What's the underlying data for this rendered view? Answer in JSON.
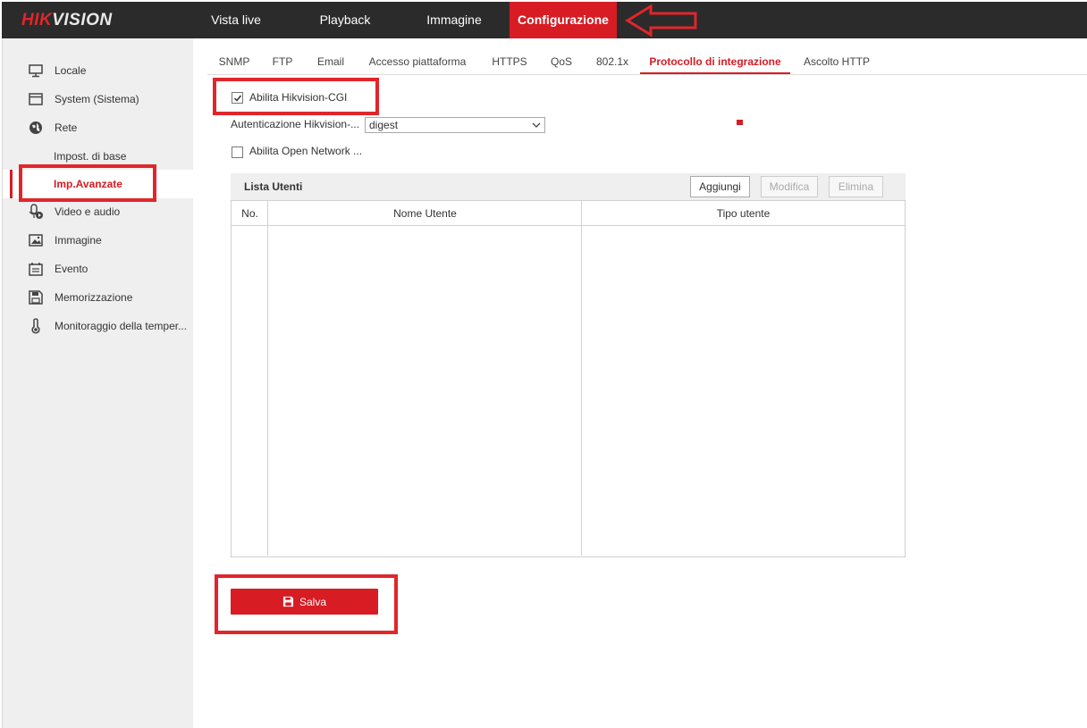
{
  "header": {
    "logo_red": "HIK",
    "logo_white": "VISION",
    "nav": [
      {
        "label": "Vista live"
      },
      {
        "label": "Playback"
      },
      {
        "label": "Immagine"
      },
      {
        "label": "Configurazione",
        "active": true
      }
    ]
  },
  "sidebar": {
    "items": [
      {
        "label": "Locale",
        "icon": "monitor-icon"
      },
      {
        "label": "System (Sistema)",
        "icon": "window-icon"
      },
      {
        "label": "Rete",
        "icon": "globe-icon"
      },
      {
        "label": "Impost. di base",
        "sub": true
      },
      {
        "label": "Imp.Avanzate",
        "sub": true,
        "active": true
      },
      {
        "label": "Video e audio",
        "icon": "microphone-icon"
      },
      {
        "label": "Immagine",
        "icon": "image-icon"
      },
      {
        "label": "Evento",
        "icon": "calendar-icon"
      },
      {
        "label": "Memorizzazione",
        "icon": "save-disk-icon"
      },
      {
        "label": "Monitoraggio della temper...",
        "icon": "thermometer-icon"
      }
    ]
  },
  "tabs": [
    {
      "label": "SNMP"
    },
    {
      "label": "FTP"
    },
    {
      "label": "Email"
    },
    {
      "label": "Accesso piattaforma"
    },
    {
      "label": "HTTPS"
    },
    {
      "label": "QoS"
    },
    {
      "label": "802.1x"
    },
    {
      "label": "Protocollo di integrazione",
      "active": true
    },
    {
      "label": "Ascolto HTTP"
    }
  ],
  "form": {
    "enable_cgi_label": "Abilita Hikvision-CGI",
    "enable_cgi_checked": true,
    "auth_label": "Autenticazione Hikvision-...",
    "auth_value": "digest",
    "enable_onvif_label": "Abilita Open Network ...",
    "enable_onvif_checked": false
  },
  "user_list": {
    "title": "Lista Utenti",
    "add_label": "Aggiungi",
    "edit_label": "Modifica",
    "delete_label": "Elimina",
    "columns": [
      "No.",
      "Nome Utente",
      "Tipo utente"
    ],
    "rows": []
  },
  "save_label": "Salva",
  "colors": {
    "accent": "#d71c24",
    "topbar": "#2b2b2b",
    "sidebar": "#efefef",
    "annotation": "#e0262b"
  }
}
